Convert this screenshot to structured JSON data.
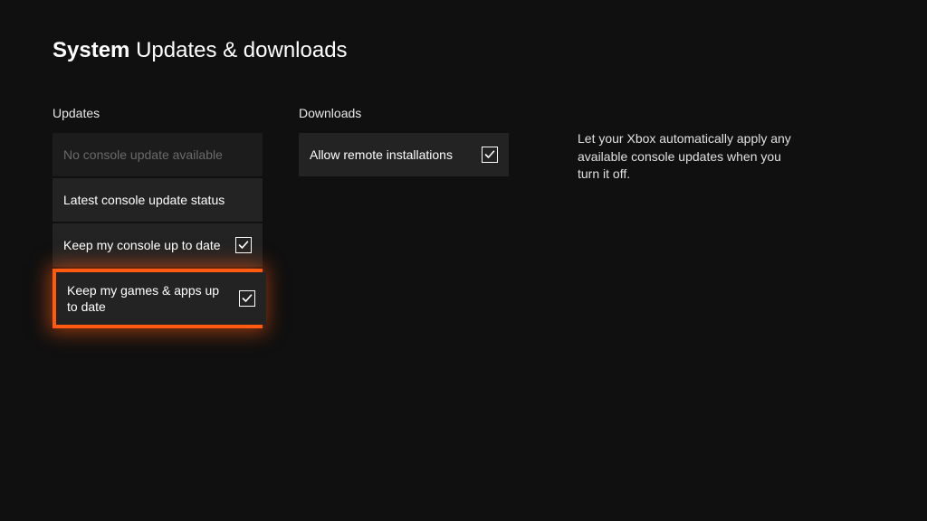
{
  "header": {
    "category": "System",
    "page": "Updates & downloads"
  },
  "updates": {
    "heading": "Updates",
    "items": {
      "no_update": "No console update available",
      "latest_status": "Latest console update status",
      "keep_console": "Keep my console up to date",
      "keep_games": "Keep my games & apps up to date"
    }
  },
  "downloads": {
    "heading": "Downloads",
    "allow_remote": "Allow remote installations"
  },
  "description": "Let your Xbox automatically apply any available console updates when you turn it off."
}
